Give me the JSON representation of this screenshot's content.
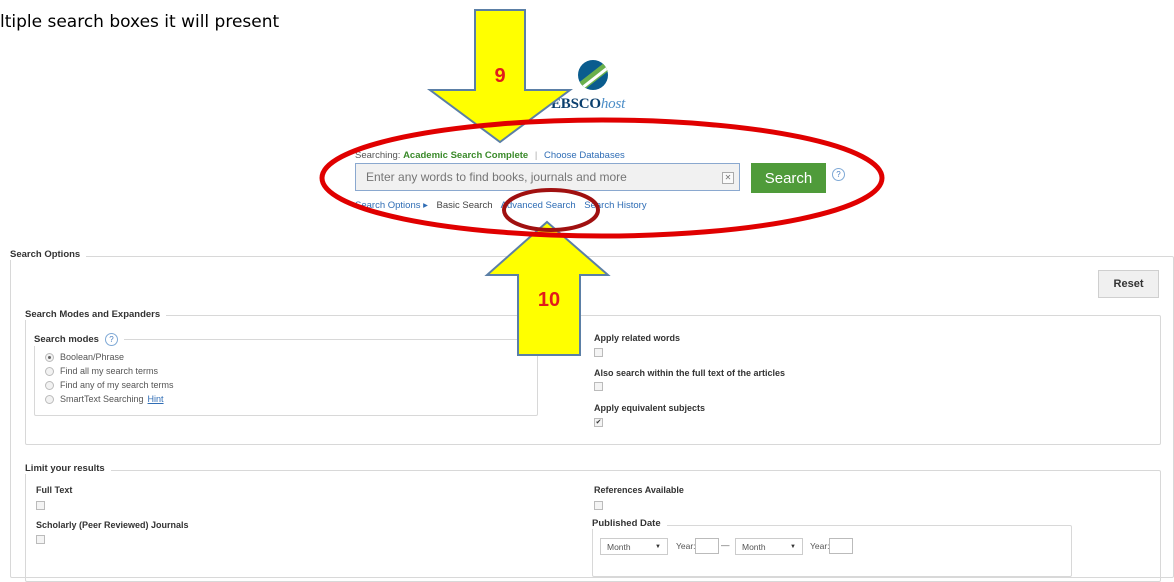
{
  "doc_text": "ltiple search boxes it will present",
  "logo": {
    "ebsco": "EBSCO",
    "host": "host"
  },
  "search": {
    "searching_label": "Searching:",
    "database": "Academic Search Complete",
    "separator": "|",
    "choose_db": "Choose Databases",
    "placeholder": "Enter any words to find books, journals and more",
    "button_label": "Search",
    "help": "?",
    "clear": "✕"
  },
  "sublinks": {
    "search_options": "Search Options ▸",
    "basic": "Basic Search",
    "advanced": "Advanced Search",
    "history": "Search History"
  },
  "search_options": {
    "title": "Search Options",
    "reset": "Reset",
    "modes_expanders_title": "Search Modes and Expanders",
    "search_modes_label": "Search modes",
    "search_modes_help": "?",
    "modes": [
      {
        "label": "Boolean/Phrase",
        "selected": true
      },
      {
        "label": "Find all my search terms",
        "selected": false
      },
      {
        "label": "Find any of my search terms",
        "selected": false
      },
      {
        "label": "SmartText Searching",
        "selected": false
      }
    ],
    "hint": "Hint",
    "expanders": [
      {
        "label": "Apply related words",
        "checked": false
      },
      {
        "label": "Also search within the full text of the articles",
        "checked": false
      },
      {
        "label": "Apply equivalent subjects",
        "checked": true
      }
    ],
    "check_mark": "✔"
  },
  "limits": {
    "title": "Limit your results",
    "full_text": "Full Text",
    "scholarly": "Scholarly (Peer Reviewed) Journals",
    "references": "References Available",
    "published_date": "Published Date",
    "month": "Month",
    "caret": "▼",
    "year": "Year:",
    "dash": "—"
  },
  "annotations": {
    "arrow_down_number": "9",
    "arrow_up_number": "10",
    "arrow_color": "#ffff00",
    "arrow_border": "#5b7fa6",
    "number_color": "#e11b1b",
    "ellipse_color": "#e00000"
  }
}
